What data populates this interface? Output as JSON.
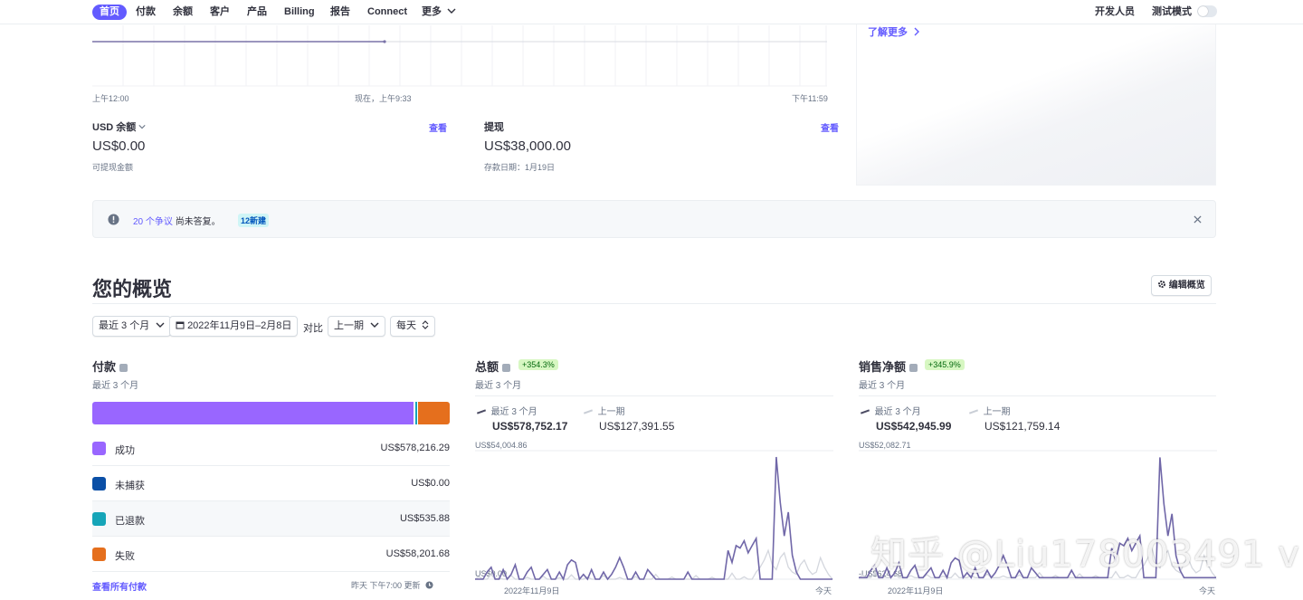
{
  "nav": {
    "items": [
      "首页",
      "付款",
      "余额",
      "客户",
      "产品",
      "Billing",
      "报告",
      "Connect",
      "更多"
    ],
    "dev_label": "开发人员",
    "test_mode_label": "测试模式",
    "test_mode_on": false
  },
  "today_chart": {
    "start_label": "上午12:00",
    "now_label": "现在，上午9:33",
    "end_label": "下午11:59"
  },
  "learn_more": "了解更多",
  "balances": {
    "usd_title": "USD 余额",
    "usd_view": "查看",
    "usd_amount": "US$0.00",
    "usd_sub": "可提现金额",
    "payout_title": "提现",
    "payout_view": "查看",
    "payout_amount": "US$38,000.00",
    "payout_sub": "存款日期：1月19日"
  },
  "banner": {
    "link_text": "20 个争议",
    "text": "尚未答复。",
    "badge": "12新建"
  },
  "overview": {
    "title": "您的概览",
    "edit_button": "编辑概览",
    "range_select": "最近 3 个月",
    "date_range": "2022年11月9日–2月8日",
    "compare_label": "对比",
    "compare_select": "上一期",
    "interval_select": "每天"
  },
  "payments": {
    "title": "付款",
    "subtitle": "最近 3 个月",
    "rows": [
      {
        "label": "成功",
        "value": "US$578,216.29",
        "color": "#9966ff"
      },
      {
        "label": "未捕获",
        "value": "US$0.00",
        "color": "#0a4fa6"
      },
      {
        "label": "已退款",
        "value": "US$535.88",
        "color": "#16a5b8"
      },
      {
        "label": "失败",
        "value": "US$58,201.68",
        "color": "#e56f1d"
      }
    ],
    "bar_fractions": [
      0.898,
      0.002,
      0.008,
      0.092
    ],
    "view_all": "查看所有付款",
    "updated": "昨天 下午7:00 更新"
  },
  "gross": {
    "title": "总额",
    "badge": "+354.3%",
    "subtitle": "最近 3 个月",
    "current_label": "最近 3 个月",
    "current_value": "US$578,752.17",
    "previous_label": "上一期",
    "previous_value": "US$127,391.55",
    "y_top": "US$54,004.86",
    "y_bottom": "US$0.00",
    "x_start": "2022年11月9日",
    "x_end": "今天"
  },
  "net": {
    "title": "销售净额",
    "badge": "+345.9%",
    "subtitle": "最近 3 个月",
    "current_label": "最近 3 个月",
    "current_value": "US$542,945.99",
    "previous_label": "上一期",
    "previous_value": "US$121,759.14",
    "y_top": "US$52,082.71",
    "y_bottom": "-US$624.68",
    "x_start": "2022年11月9日",
    "x_end": "今天"
  },
  "chart_data": [
    {
      "type": "line",
      "title": "总额",
      "ylim": [
        0,
        54004.86
      ],
      "series": [
        {
          "name": "最近 3 个月",
          "values": [
            0,
            0,
            0,
            3000,
            5000,
            0,
            0,
            4000,
            0,
            2000,
            6000,
            0,
            0,
            3000,
            5000,
            0,
            0,
            2000,
            4000,
            0,
            0,
            3000,
            0,
            6000,
            8000,
            7000,
            0,
            2000,
            0,
            4000,
            0,
            0,
            3000,
            0,
            2000,
            5000,
            9000,
            5000,
            0,
            0,
            3000,
            0,
            0,
            4000,
            2000,
            0,
            0,
            0,
            0,
            0,
            0,
            0,
            0,
            3000,
            0,
            0,
            0,
            0,
            0,
            0,
            0,
            0,
            0,
            12000,
            7000,
            14000,
            13000,
            16000,
            11000,
            14000,
            17000,
            0,
            0,
            0,
            0,
            51000,
            32000,
            18000,
            28000,
            10000,
            3000,
            0,
            0,
            0,
            0,
            0,
            0,
            0,
            0,
            0
          ]
        },
        {
          "name": "上一期",
          "values": [
            0,
            1000,
            0,
            0,
            2000,
            0,
            500,
            0,
            0,
            1500,
            0,
            0,
            0,
            800,
            0,
            0,
            0,
            1200,
            0,
            0,
            0,
            600,
            0,
            0,
            1800,
            0,
            0,
            0,
            900,
            0,
            0,
            0,
            1500,
            0,
            0,
            0,
            700,
            0,
            0,
            0,
            1100,
            0,
            0,
            0,
            0,
            2000,
            0,
            0,
            0,
            900,
            0,
            0,
            0,
            0,
            0,
            1500,
            0,
            0,
            0,
            800,
            0,
            0,
            0,
            0,
            2500,
            0,
            0,
            1000,
            0,
            0,
            3000,
            5000,
            8000,
            12000,
            6000,
            4000,
            9000,
            11000,
            5000,
            3000,
            2000,
            6000,
            8000,
            4000,
            2000,
            3000,
            9000,
            5000,
            2000,
            0
          ]
        }
      ]
    },
    {
      "type": "line",
      "title": "销售净额",
      "ylim": [
        -624.68,
        52082.71
      ],
      "series": [
        {
          "name": "最近 3 个月",
          "values": [
            0,
            0,
            0,
            3000,
            5000,
            0,
            0,
            4000,
            0,
            2000,
            6000,
            0,
            0,
            3000,
            5000,
            0,
            0,
            2000,
            4000,
            0,
            0,
            3000,
            0,
            6000,
            8000,
            7000,
            0,
            2000,
            0,
            4000,
            0,
            0,
            3000,
            0,
            2000,
            5000,
            9000,
            5000,
            0,
            0,
            3000,
            0,
            0,
            4000,
            2000,
            0,
            0,
            0,
            0,
            0,
            0,
            0,
            0,
            3000,
            0,
            0,
            0,
            0,
            0,
            0,
            0,
            0,
            0,
            12000,
            7000,
            14000,
            13000,
            16000,
            11000,
            14000,
            17000,
            0,
            0,
            0,
            0,
            49000,
            30000,
            17000,
            26000,
            9000,
            3000,
            0,
            0,
            0,
            0,
            0,
            0,
            0,
            0,
            0
          ]
        },
        {
          "name": "上一期",
          "values": [
            0,
            1000,
            0,
            0,
            2000,
            0,
            500,
            0,
            0,
            1500,
            0,
            0,
            0,
            800,
            0,
            0,
            0,
            1200,
            0,
            0,
            0,
            600,
            0,
            0,
            1800,
            0,
            0,
            0,
            900,
            0,
            0,
            0,
            1500,
            0,
            0,
            0,
            700,
            0,
            0,
            0,
            1100,
            0,
            0,
            0,
            0,
            2000,
            0,
            0,
            0,
            900,
            0,
            0,
            0,
            0,
            0,
            1500,
            0,
            0,
            0,
            800,
            0,
            0,
            0,
            0,
            2500,
            0,
            0,
            1000,
            0,
            0,
            3000,
            5000,
            8000,
            12000,
            6000,
            4000,
            9000,
            11000,
            5000,
            3000,
            2000,
            6000,
            8000,
            4000,
            2000,
            3000,
            9000,
            5000,
            2000,
            0
          ]
        }
      ]
    }
  ],
  "watermark": "知乎 @Liu178003491 v"
}
